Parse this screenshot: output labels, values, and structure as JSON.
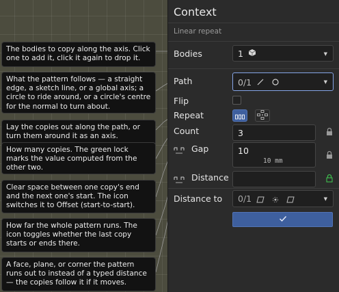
{
  "panel": {
    "title": "Context",
    "subtitle": "Linear repeat",
    "bodies": {
      "label": "Bodies",
      "value": "1"
    },
    "path": {
      "label": "Path",
      "value": "0/1"
    },
    "flip": {
      "label": "Flip"
    },
    "repeat": {
      "label": "Repeat"
    },
    "count": {
      "label": "Count",
      "value": "3"
    },
    "gap": {
      "label": "Gap",
      "value": "10",
      "computed": "10 mm"
    },
    "distance": {
      "label": "Distance",
      "value": ""
    },
    "distance_to": {
      "label": "Distance to",
      "value": "0/1"
    }
  },
  "tooltips": [
    "The bodies to copy along the axis. Click one to add it, click it again to drop it.",
    "What the pattern follows — a straight edge, a sketch line, or a global axis; a circle to ride around, or a circle's centre for the normal to turn about.",
    "Lay the copies out along the path, or turn them around it as an axis.",
    "How many copies. The green lock marks the value computed from the other two.",
    "Clear space between one copy's end and the next one's start. The icon switches it to Offset (start-to-start).",
    "How far the whole pattern runs. The icon toggles whether the last copy starts or ends there.",
    "A face, plane, or corner the pattern runs out to instead of a typed distance — the copies follow it if it moves."
  ],
  "colors": {
    "accent": "#86a6e8",
    "confirm": "#3e5f9e",
    "lock_green": "#3fbf4f"
  },
  "icons": [
    "cube-icon",
    "line-icon",
    "circle-icon",
    "dropdown-caret-icon",
    "lock-icon",
    "gap-mode-icon",
    "distance-mode-icon",
    "face-icon",
    "vertex-icon",
    "plane-icon",
    "linear-mode-icon",
    "rotate-mode-icon",
    "checkmark-icon"
  ]
}
